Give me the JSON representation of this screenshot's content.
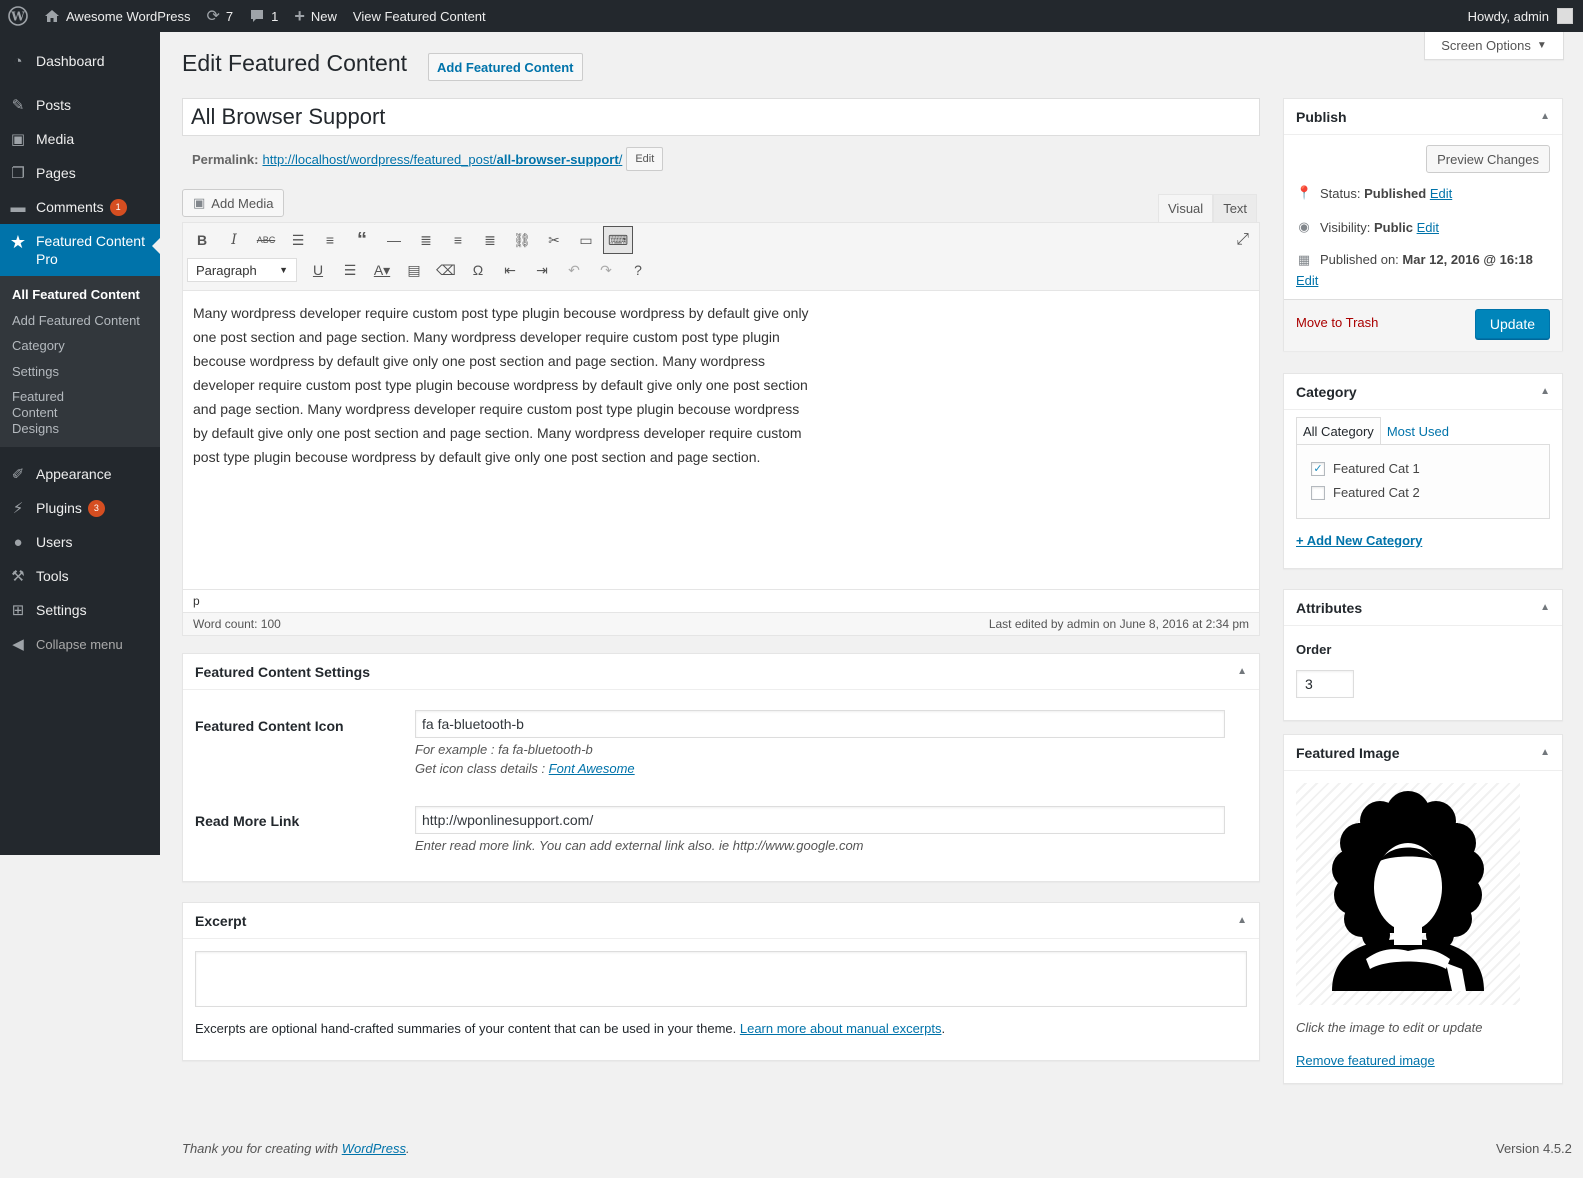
{
  "adminbar": {
    "site_name": "Awesome WordPress",
    "updates_count": "7",
    "comments_count": "1",
    "new_label": "New",
    "view_label": "View Featured Content",
    "howdy": "Howdy, admin"
  },
  "sidebar": {
    "items": [
      {
        "label": "Dashboard"
      },
      {
        "label": "Posts"
      },
      {
        "label": "Media"
      },
      {
        "label": "Pages"
      },
      {
        "label": "Comments",
        "badge": "1"
      },
      {
        "label": "Featured Content Pro"
      },
      {
        "label": "Appearance"
      },
      {
        "label": "Plugins",
        "badge": "3"
      },
      {
        "label": "Users"
      },
      {
        "label": "Tools"
      },
      {
        "label": "Settings"
      },
      {
        "label": "Collapse menu"
      }
    ],
    "submenu": [
      "All Featured Content",
      "Add Featured Content",
      "Category",
      "Settings",
      "Featured Content Designs"
    ]
  },
  "screen_options": "Screen Options",
  "page": {
    "title": "Edit Featured Content",
    "add_new": "Add Featured Content",
    "post_title": "All Browser Support",
    "permalink_label": "Permalink:",
    "permalink_base": "http://localhost/wordpress/featured_post/",
    "permalink_slug": "all-browser-support",
    "permalink_trail": "/",
    "permalink_edit": "Edit"
  },
  "editor": {
    "add_media": "Add Media",
    "tab_visual": "Visual",
    "tab_text": "Text",
    "format": "Paragraph",
    "content": "Many wordpress developer require custom post type plugin becouse wordpress by default give only one post section and page section. Many wordpress developer require custom post type plugin becouse wordpress by default give only one post section and page section. Many wordpress developer require custom post type plugin becouse wordpress by default give only one post section and page section. Many wordpress developer require custom post type plugin becouse wordpress by default give only one post section and page section. Many wordpress developer require custom post type plugin becouse wordpress by default give only one post section and page section.",
    "path": "p",
    "word_count": "Word count: 100",
    "last_edited": "Last edited by admin on June 8, 2016 at 2:34 pm"
  },
  "fc_settings": {
    "title": "Featured Content Settings",
    "icon_label": "Featured Content Icon",
    "icon_value": "fa fa-bluetooth-b",
    "icon_example": "For example : fa fa-bluetooth-b",
    "icon_details_prefix": "Get icon class details : ",
    "icon_details_link": "Font Awesome",
    "readmore_label": "Read More Link",
    "readmore_value": "http://wponlinesupport.com/",
    "readmore_desc": "Enter read more link. You can add external link also. ie http://www.google.com"
  },
  "excerpt": {
    "title": "Excerpt",
    "help_prefix": "Excerpts are optional hand-crafted summaries of your content that can be used in your theme. ",
    "help_link": "Learn more about manual excerpts",
    "help_suffix": "."
  },
  "publish": {
    "title": "Publish",
    "preview": "Preview Changes",
    "status_label": "Status: ",
    "status_value": "Published",
    "visibility_label": "Visibility: ",
    "visibility_value": "Public",
    "published_label": "Published on: ",
    "published_value": "Mar 12, 2016 @ 16:18",
    "edit": "Edit",
    "trash": "Move to Trash",
    "update": "Update"
  },
  "category": {
    "title": "Category",
    "tab_all": "All Category",
    "tab_most": "Most Used",
    "items": [
      {
        "label": "Featured Cat 1",
        "checked": true
      },
      {
        "label": "Featured Cat 2",
        "checked": false
      }
    ],
    "add_new": "+ Add New Category"
  },
  "attributes": {
    "title": "Attributes",
    "order_label": "Order",
    "order_value": "3"
  },
  "featured_image": {
    "title": "Featured Image",
    "help": "Click the image to edit or update",
    "remove": "Remove featured image"
  },
  "footer": {
    "thanks_prefix": "Thank you for creating with ",
    "thanks_link": "WordPress",
    "thanks_suffix": ".",
    "version": "Version 4.5.2"
  },
  "colors": {
    "accent": "#0073aa",
    "primary_button": "#0085ba",
    "adminbar": "#23282d",
    "badge": "#d54e21"
  }
}
